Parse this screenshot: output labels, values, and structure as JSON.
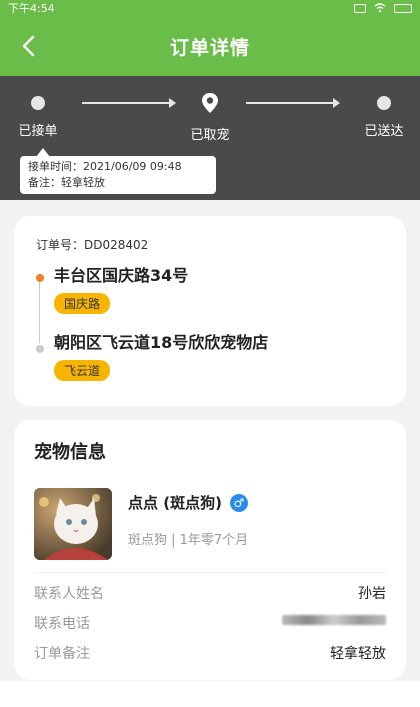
{
  "statusbar": {
    "time": "下午4:54"
  },
  "header": {
    "title": "订单详情"
  },
  "progress": {
    "steps": [
      {
        "label": "已接单"
      },
      {
        "label": "已取宠"
      },
      {
        "label": "已送达"
      }
    ],
    "tooltip": {
      "time_line": "接单时间：2021/06/09 09:48",
      "note_line": "备注：轻拿轻放"
    }
  },
  "order": {
    "order_no": "订单号：DD028402",
    "from": {
      "address": "丰台区国庆路34号",
      "tag": "国庆路"
    },
    "to": {
      "address": "朝阳区飞云道18号欣欣宠物店",
      "tag": "飞云道"
    }
  },
  "pet": {
    "section_title": "宠物信息",
    "name": "点点 (斑点狗)",
    "gender_symbol": "♂",
    "sub": "斑点狗 | 1年零7个月",
    "fields": [
      {
        "key": "联系人姓名",
        "value": "孙岩"
      },
      {
        "key": "联系电话",
        "value": ""
      },
      {
        "key": "订单备注",
        "value": "轻拿轻放"
      }
    ]
  },
  "colors": {
    "primary": "#6bbd4a",
    "progress_bg": "#4a4a4a",
    "tag": "#f7b500",
    "accent": "#f07f2a"
  }
}
